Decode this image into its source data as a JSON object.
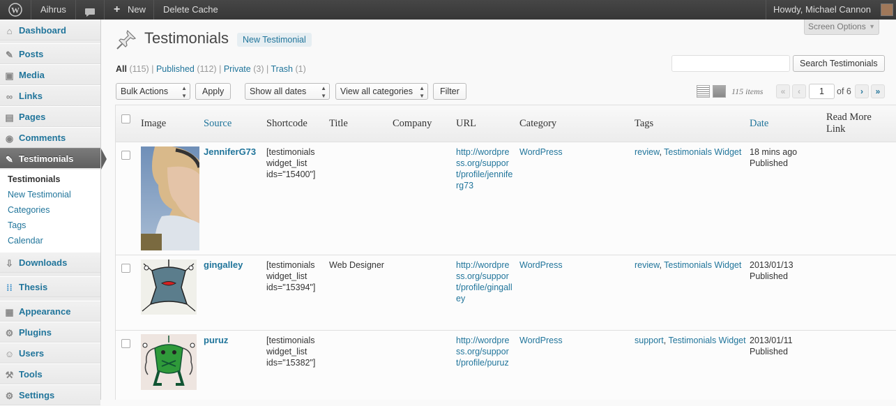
{
  "adminbar": {
    "site_name": "Aihrus",
    "new_label": "New",
    "delete_cache": "Delete Cache",
    "howdy": "Howdy, Michael Cannon"
  },
  "sidebar": {
    "items": [
      {
        "label": "Dashboard",
        "icon": "dashboard-icon"
      },
      {
        "label": "Posts",
        "icon": "pushpin-icon"
      },
      {
        "label": "Media",
        "icon": "media-icon"
      },
      {
        "label": "Links",
        "icon": "link-icon"
      },
      {
        "label": "Pages",
        "icon": "page-icon"
      },
      {
        "label": "Comments",
        "icon": "comment-icon"
      },
      {
        "label": "Testimonials",
        "icon": "pushpin-icon"
      },
      {
        "label": "Downloads",
        "icon": "download-icon"
      },
      {
        "label": "Thesis",
        "icon": "thesis-icon"
      },
      {
        "label": "Appearance",
        "icon": "appearance-icon"
      },
      {
        "label": "Plugins",
        "icon": "plugin-icon"
      },
      {
        "label": "Users",
        "icon": "users-icon"
      },
      {
        "label": "Tools",
        "icon": "tools-icon"
      },
      {
        "label": "Settings",
        "icon": "settings-icon"
      }
    ],
    "submenu": [
      "Testimonials",
      "New Testimonial",
      "Categories",
      "Tags",
      "Calendar"
    ]
  },
  "header": {
    "title": "Testimonials",
    "add_new": "New Testimonial",
    "screen_options": "Screen Options"
  },
  "filters": {
    "all": "All",
    "all_count": "(115)",
    "published": "Published",
    "published_count": "(112)",
    "private": "Private",
    "private_count": "(3)",
    "trash": "Trash",
    "trash_count": "(1)",
    "sep": "|"
  },
  "search": {
    "button": "Search Testimonials",
    "value": ""
  },
  "toolbar": {
    "bulk_actions": "Bulk Actions",
    "apply": "Apply",
    "dates": "Show all dates",
    "categories": "View all categories",
    "filter": "Filter"
  },
  "pagination": {
    "items": "115 items",
    "first": "«",
    "prev": "‹",
    "current": "1",
    "of": "of 6",
    "next": "›",
    "last": "»"
  },
  "table": {
    "columns": [
      "Image",
      "Source",
      "Shortcode",
      "Title",
      "Company",
      "URL",
      "Category",
      "Tags",
      "Date",
      "Read More Link"
    ],
    "rows": [
      {
        "source": "JenniferG73",
        "shortcode": "[testimonials widget_list ids=\"15400\"]",
        "title": "",
        "company": "",
        "url": "http://wordpress.org/support/profile/jenniferg73",
        "category": "WordPress",
        "tag1": "review",
        "tag2": "Testimonials Widget",
        "date": "18 mins ago",
        "status": "Published"
      },
      {
        "source": "gingalley",
        "shortcode": "[testimonials widget_list ids=\"15394\"]",
        "title": "Web Designer",
        "company": "",
        "url": "http://wordpress.org/support/profile/gingalley",
        "category": "WordPress",
        "tag1": "review",
        "tag2": "Testimonials Widget",
        "date": "2013/01/13",
        "status": "Published"
      },
      {
        "source": "puruz",
        "shortcode": "[testimonials widget_list ids=\"15382\"]",
        "title": "",
        "company": "",
        "url": "http://wordpress.org/support/profile/puruz",
        "category": "WordPress",
        "tag1": "support",
        "tag2": "Testimonials Widget",
        "date": "2013/01/11",
        "status": "Published"
      }
    ]
  }
}
